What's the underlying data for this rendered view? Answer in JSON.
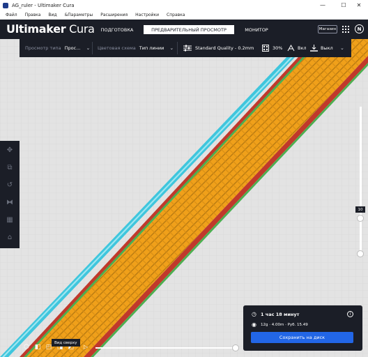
{
  "window": {
    "title": "AG_ruler - Ultimaker Cura",
    "minimize": "—",
    "maximize": "☐",
    "close": "✕"
  },
  "menu": [
    "Файл",
    "Правка",
    "Вид",
    "&Параметры",
    "Расширения",
    "Настройки",
    "Справка"
  ],
  "header": {
    "logo_bold": "Ultimaker",
    "logo_light": " Cura",
    "stages": [
      "ПОДГОТОВКА",
      "ПРЕДВАРИТЕЛЬНЫЙ ПРОСМОТР",
      "МОНИТОР"
    ],
    "active_stage": "ПРЕДВАРИТЕЛЬНЫЙ ПРОСМОТР",
    "marketplace": "Магазин",
    "account_initial": "N"
  },
  "view_toolbar": {
    "view_type_label": "Просмотр типа",
    "view_type_value": "Прос...",
    "color_scheme_label": "Цветовая схема",
    "color_scheme_value": "Тип линии",
    "profile": "Standard Quality - 0.2mm",
    "infill": "30%",
    "support": "Вкл",
    "adhesion": "Выкл"
  },
  "layer_view": {
    "current_layer": "10"
  },
  "bottom": {
    "tooltip": "Вид сверху"
  },
  "print_info": {
    "time": "1 час 18 минут",
    "material": "12g · 4.00m · Руб. 15.49",
    "save_button": "Сохранить на диск"
  },
  "colors": {
    "accent": "#2266e6",
    "dark": "#1b1e27",
    "infill": "#f0a01a",
    "wall": "#c0392b",
    "skirt": "#3fc6dd"
  }
}
